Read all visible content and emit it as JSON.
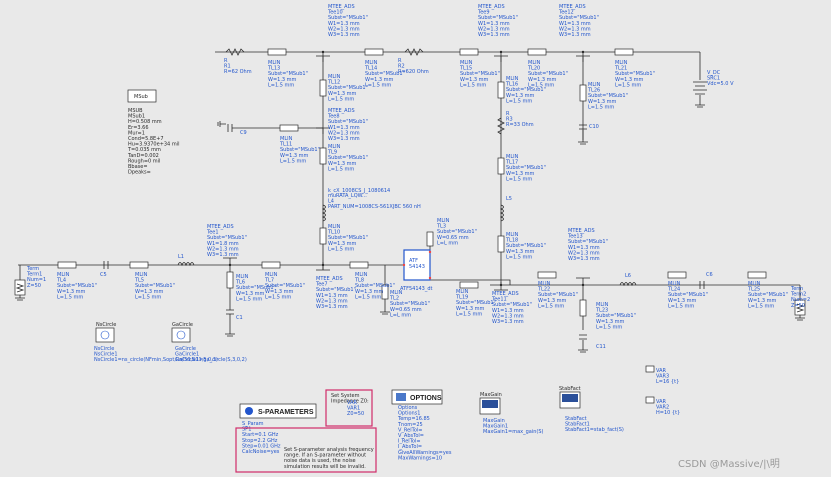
{
  "msub": {
    "button": "MSub",
    "lines": [
      "MSUB",
      "MSub1",
      "H=0.508 mm",
      "Er=3.66",
      "Mur=1",
      "Cond=5.8E+7",
      "Hu=3.9370e+34 mil",
      "T=0.035 mm",
      "TanD=0.002",
      "Rough=0 mil",
      "Bbase=",
      "Dpeaks="
    ]
  },
  "r1": [
    "R",
    "R1",
    "R=62 Ohm"
  ],
  "r2": [
    "R",
    "R2",
    "R=620 Ohm"
  ],
  "r3": [
    "R",
    "R3",
    "R=33 Ohm"
  ],
  "tl13": [
    "MLIN",
    "TL13",
    "Subst=\"MSub1\"",
    "W=1.3 mm",
    "L=1.5 mm"
  ],
  "tl14": [
    "MLIN",
    "TL14",
    "Subst=\"MSub1\"",
    "W=1.3 mm",
    "L=1.5 mm"
  ],
  "tl15": [
    "MLIN",
    "TL15",
    "Subst=\"MSub1\"",
    "W=1.3 mm",
    "L=1.5 mm"
  ],
  "tl20": [
    "MLIN",
    "TL20",
    "Subst=\"MSub1\"",
    "W=1.3 mm",
    "L=1.5 mm"
  ],
  "tl21": [
    "MLIN",
    "TL21",
    "Subst=\"MSub1\"",
    "W=1.3 mm",
    "L=1.5 mm"
  ],
  "tee10": [
    "MTEE_ADS",
    "Tee10",
    "Subst=\"MSub1\"",
    "W1=1.3 mm",
    "W2=1.3 mm",
    "W3=1.3 mm"
  ],
  "tee9": [
    "MTEE_ADS",
    "Tee9",
    "Subst=\"MSub1\"",
    "W1=1.3 mm",
    "W2=1.3 mm",
    "W3=1.3 mm"
  ],
  "tee12": [
    "MTEE_ADS",
    "Tee12",
    "Subst=\"MSub1\"",
    "W1=1.3 mm",
    "W2=1.3 mm",
    "W3=1.3 mm"
  ],
  "tl12": [
    "MLIN",
    "TL12",
    "Subst=\"MSub1\"",
    "W=1.3 mm",
    "L=1.5 mm"
  ],
  "tee8": [
    "MTEE_ADS",
    "Tee8",
    "Subst=\"MSub1\"",
    "W1=1.3 mm",
    "W2=1.3 mm",
    "W3=1.3 mm"
  ],
  "tl11": [
    "MLIN",
    "TL11",
    "Subst=\"MSub1\"",
    "W=1.3 mm",
    "L=1.5 mm"
  ],
  "tl9": [
    "MLIN",
    "TL9",
    "Subst=\"MSub1\"",
    "W=1.3 mm",
    "L=1.5 mm"
  ],
  "l4": [
    "muRATA_LQW...",
    "L4",
    "PART_NUM=1008CS-561XJBC 560 nH"
  ],
  "l4b": [
    "k_cX_1008CS_J_1080614"
  ],
  "tl10": [
    "MLIN",
    "TL10",
    "Subst=\"MSub1\"",
    "W=1.3 mm",
    "L=1.5 mm"
  ],
  "tl16": [
    "MLIN",
    "TL16",
    "Subst=\"MSub1\"",
    "W=1.3 mm",
    "L=1.5 mm"
  ],
  "tl17": [
    "MLIN",
    "TL17",
    "Subst=\"MSub1\"",
    "W=1.3 mm",
    "L=1.5 mm"
  ],
  "tl18b": [
    "MLIN",
    "TL18",
    "Subst=\"MSub1\"",
    "W=1.3 mm",
    "L=1.5 mm"
  ],
  "l5": [
    "L5"
  ],
  "tl26": [
    "MLIN",
    "TL26",
    "Subst=\"MSub1\"",
    "W=1.3 mm",
    "L=1.5 mm"
  ],
  "c10": [
    "C10"
  ],
  "vdc": [
    "V_DC",
    "SRC1",
    "Vdc=5.0 V"
  ],
  "c9": [
    "C9"
  ],
  "tee1": [
    "MTEE_ADS",
    "Tee1",
    "Subst=\"MSub1\"",
    "W1=1.8 mm",
    "W2=1.3 mm",
    "W3=1.3 mm"
  ],
  "l1": [
    "L1"
  ],
  "term1": [
    "Term",
    "Term1",
    "Num=1",
    "Z=50"
  ],
  "tl4": [
    "MLIN",
    "TL4",
    "Subst=\"MSub1\"",
    "W=1.3 mm",
    "L=1.5 mm"
  ],
  "c5": [
    "C5"
  ],
  "tl5": [
    "MLIN",
    "TL5",
    "Subst=\"MSub1\"",
    "W=1.3 mm",
    "L=1.5 mm"
  ],
  "tl6": [
    "MLIN",
    "TL6",
    "Subst=\"MSub1\"",
    "W=1.3 mm",
    "L=1.5 mm"
  ],
  "tl7": [
    "MLIN",
    "TL7",
    "Subst=\"MSub1\"",
    "W=1.3 mm",
    "L=1.5 mm"
  ],
  "c1": [
    "C1"
  ],
  "tee7": [
    "MTEE_ADS",
    "Tee7",
    "Subst=\"MSub1\"",
    "W1=1.3 mm",
    "W2=1.3 mm",
    "W3=1.3 mm"
  ],
  "tl8": [
    "MLIN",
    "TL8",
    "Subst=\"MSub1\"",
    "W=1.3 mm",
    "L=1.5 mm"
  ],
  "tl3": [
    "MLIN",
    "TL3",
    "Subst=\"MSub1\"",
    "W=0.65 mm",
    "L=L mm"
  ],
  "tl2": [
    "MLIN",
    "TL2",
    "Subst=\"MSub1\"",
    "W=0.65 mm",
    "L=L mm"
  ],
  "atf": [
    "ATF",
    "54143"
  ],
  "atf_lbl": [
    "ATF54143_dt"
  ],
  "tl19": [
    "MLIN",
    "TL19",
    "Subst=\"MSub1\"",
    "W=1.3 mm",
    "L=1.5 mm"
  ],
  "tee11": [
    "MTEE_ADS",
    "Tee11",
    "Subst=\"MSub1\"",
    "W1=1.3 mm",
    "W2=1.3 mm",
    "W3=1.3 mm"
  ],
  "tl22": [
    "MLIN",
    "TL22",
    "Subst=\"MSub1\"",
    "W=1.3 mm",
    "L=1.5 mm"
  ],
  "tee13": [
    "MTEE_ADS",
    "Tee13",
    "Subst=\"MSub1\"",
    "W1=1.3 mm",
    "W2=1.3 mm",
    "W3=1.3 mm"
  ],
  "l6": [
    "L6"
  ],
  "tl23": [
    "MLIN",
    "TL23",
    "Subst=\"MSub1\"",
    "W=1.3 mm",
    "L=1.5 mm"
  ],
  "c11": [
    "C11"
  ],
  "tl24": [
    "MLIN",
    "TL24",
    "Subst=\"MSub1\"",
    "W=1.3 mm",
    "L=1.5 mm"
  ],
  "c6": [
    "C6"
  ],
  "tl25": [
    "MLIN",
    "TL25",
    "Subst=\"MSub1\"",
    "W=1.3 mm",
    "L=1.5 mm"
  ],
  "term2": [
    "Term",
    "Term2",
    "Num=2",
    "Z=50"
  ],
  "nscircle": {
    "button": "NsCircle",
    "lines": [
      "NsCircle",
      "NsCircle1",
      "NsCircle1=ns_circle(NFmin,Sopt,Rn/50,S11,5,0,1)"
    ]
  },
  "gacircle": {
    "button": "GaCircle",
    "lines": [
      "GaCircle",
      "GaCircle1",
      "GaCircle1=ga_circle(S,3,0,2)"
    ]
  },
  "sparams": {
    "title": "S-PARAMETERS",
    "lines": [
      "S_Param",
      "SP1",
      "Start=0.1 GHz",
      "Stop=2.2 GHz",
      "Step=0.01 GHz",
      "CalcNoise=yes"
    ],
    "note": [
      "Set S-parameter analysis frequency",
      "range.  If an S-parameter without",
      "noise data is used, the noise",
      "simulation results will be invalid."
    ]
  },
  "sysimp": [
    "Set System",
    "Impedance Z0:"
  ],
  "var1": [
    "VAR",
    "VAR1",
    "Z0=50"
  ],
  "options": {
    "title": "OPTIONS",
    "lines": [
      "Options",
      "Options1",
      "Temp=16.85",
      "Tnom=25",
      "V_RelTol=",
      "V_AbsTol=",
      "I_RelTol=",
      "I_AbsTol=",
      "GiveAllWarnings=yes",
      "MaxWarnings=10"
    ]
  },
  "maxgain": {
    "button": "MaxGain",
    "lines": [
      "MaxGain",
      "MaxGain1",
      "MaxGain1=max_gain(S)"
    ]
  },
  "stabfact": {
    "button": "StabFact",
    "lines": [
      "StabFact",
      "StabFact1",
      "StabFact1=stab_fact(S)"
    ]
  },
  "var3": [
    "VAR",
    "VAR3",
    "L=16 {t}"
  ],
  "var2": [
    "VAR",
    "VAR2",
    "H=10 {t}"
  ],
  "watermark": "CSDN @Massive/|\\明"
}
